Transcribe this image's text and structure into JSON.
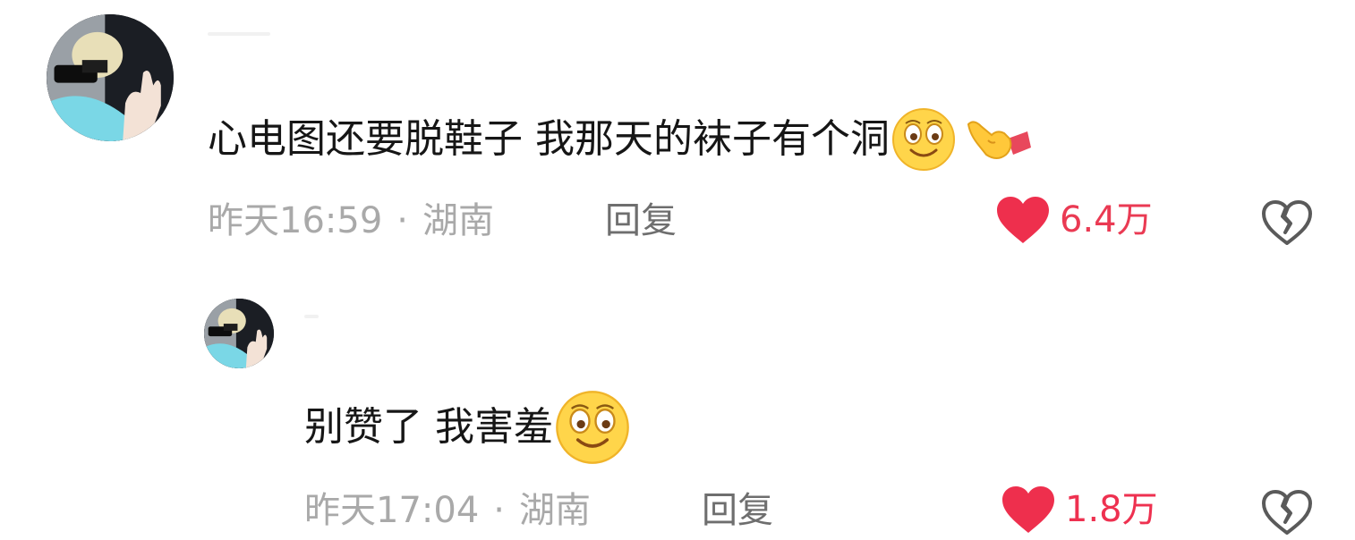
{
  "comments": [
    {
      "text": "心电图还要脱鞋子 我那天的袜子有个洞",
      "time": "昨天16:59",
      "separator": "·",
      "location": "湖南",
      "reply_label": "回复",
      "likes": "6.4万",
      "emojis": [
        "smiling-emoji",
        "pointing-hand-emoji"
      ]
    },
    {
      "text": "别赞了 我害羞",
      "time": "昨天17:04",
      "separator": "·",
      "location": "湖南",
      "reply_label": "回复",
      "likes": "1.8万",
      "emojis": [
        "smiling-emoji"
      ]
    }
  ],
  "colors": {
    "like_heart": "#ee2f4d",
    "like_count": "#ea3a53",
    "meta_text": "#a9a9a9",
    "reply_text": "#6e6e6e",
    "body_text": "#161616"
  },
  "icons": {
    "like": "heart-icon",
    "dislike": "broken-heart-icon"
  }
}
